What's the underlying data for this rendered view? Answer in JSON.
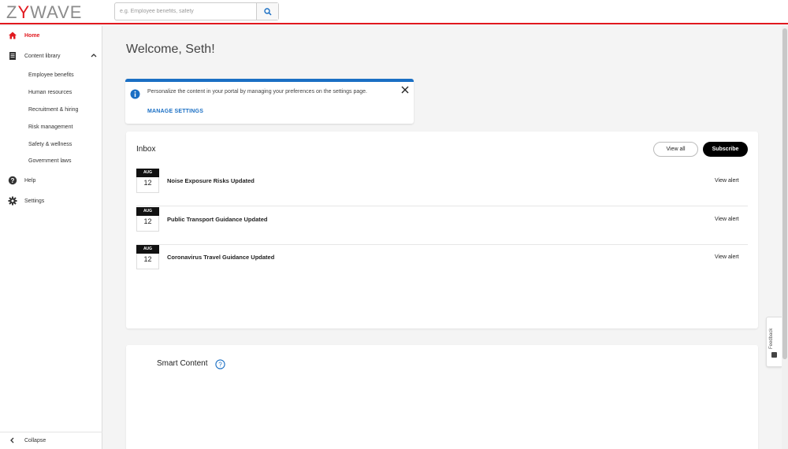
{
  "header": {
    "logo_z": "Z",
    "logo_y": "Y",
    "logo_rest": "WAVE",
    "search_placeholder": "e.g. Employee benefits, safety"
  },
  "sidebar": {
    "home": "Home",
    "content_library": "Content library",
    "sub_items": [
      "Employee benefits",
      "Human resources",
      "Recruitment & hiring",
      "Risk management",
      "Safety & wellness",
      "Government laws"
    ],
    "help": "Help",
    "settings": "Settings",
    "collapse": "Collapse"
  },
  "main": {
    "welcome": "Welcome, Seth!",
    "banner": {
      "message": "Personalize the content in your portal by managing your preferences on the settings page.",
      "action": "MANAGE SETTINGS"
    },
    "inbox": {
      "title": "Inbox",
      "view_all": "View all",
      "subscribe": "Subscribe",
      "items": [
        {
          "month": "AUG",
          "day": "12",
          "title": "Noise Exposure Risks Updated",
          "action": "View alert"
        },
        {
          "month": "AUG",
          "day": "12",
          "title": "Public Transport Guidance Updated",
          "action": "View alert"
        },
        {
          "month": "AUG",
          "day": "12",
          "title": "Coronavirus Travel Guidance Updated",
          "action": "View alert"
        }
      ]
    },
    "smart_content": {
      "title": "Smart Content"
    }
  },
  "feedback": "Feedback",
  "colors": {
    "brand_red": "#e1191f",
    "accent_blue": "#1a6fc4"
  }
}
